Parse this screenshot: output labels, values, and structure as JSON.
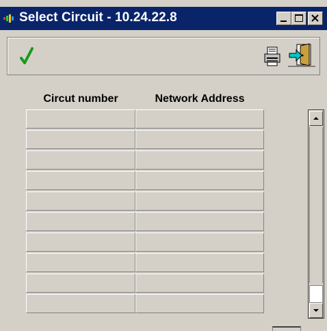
{
  "window": {
    "title": "Select Circuit - 10.24.22.8"
  },
  "titlebar_buttons": [
    {
      "name": "minimize"
    },
    {
      "name": "maximize"
    },
    {
      "name": "close"
    }
  ],
  "toolbar": {
    "buttons": [
      {
        "name": "confirm",
        "icon": "checkmark-icon"
      },
      {
        "name": "print",
        "icon": "printer-icon"
      },
      {
        "name": "exit",
        "icon": "exit-door-icon"
      }
    ]
  },
  "table": {
    "columns": [
      "Circut number",
      "Network Address"
    ],
    "rows": [
      [
        "",
        ""
      ],
      [
        "",
        ""
      ],
      [
        "",
        ""
      ],
      [
        "",
        ""
      ],
      [
        "",
        ""
      ],
      [
        "",
        ""
      ],
      [
        "",
        ""
      ],
      [
        "",
        ""
      ],
      [
        "",
        ""
      ],
      [
        "",
        ""
      ]
    ]
  },
  "colors": {
    "titlebar": "#0a246a",
    "face": "#d4d0c8",
    "check": "#1a9a1a"
  }
}
